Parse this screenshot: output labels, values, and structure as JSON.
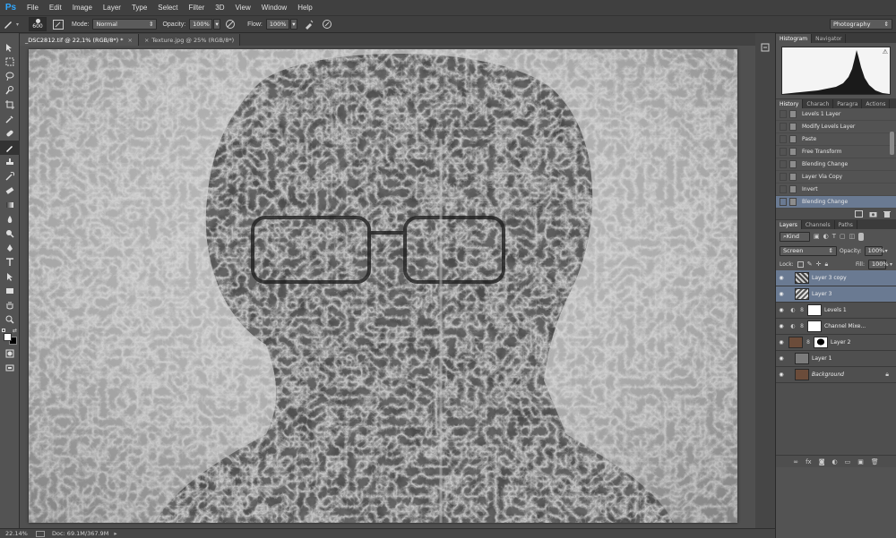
{
  "app": {
    "logo": "Ps"
  },
  "menu": [
    "File",
    "Edit",
    "Image",
    "Layer",
    "Type",
    "Select",
    "Filter",
    "3D",
    "View",
    "Window",
    "Help"
  ],
  "options": {
    "brush_size": "600",
    "mode_label": "Mode:",
    "mode_value": "Normal",
    "opacity_label": "Opacity:",
    "opacity_value": "100%",
    "flow_label": "Flow:",
    "flow_value": "100%",
    "workspace": "Photography"
  },
  "documents": [
    {
      "title": "_DSC2812.tif @ 22,1% (RGB/8*) *",
      "active": true
    },
    {
      "title": "Texture.jpg @ 25% (RGB/8*)",
      "active": false
    }
  ],
  "status": {
    "zoom": "22.14%",
    "doc_info": "Doc: 69.1M/367.9M"
  },
  "histogram_panel": {
    "tabs": [
      "Histogram",
      "Navigator"
    ]
  },
  "history_panel": {
    "tabs": [
      "History",
      "Charach",
      "Paragra",
      "Actions"
    ],
    "items": [
      {
        "label": "Levels 1 Layer",
        "selected": false
      },
      {
        "label": "Modify Levels Layer",
        "selected": false
      },
      {
        "label": "Paste",
        "selected": false
      },
      {
        "label": "Free Transform",
        "selected": false
      },
      {
        "label": "Blending Change",
        "selected": false
      },
      {
        "label": "Layer Via Copy",
        "selected": false
      },
      {
        "label": "Invert",
        "selected": false
      },
      {
        "label": "Blending Change",
        "selected": true
      }
    ]
  },
  "layers_panel": {
    "tabs": [
      "Layers",
      "Channels",
      "Paths"
    ],
    "filter": "Kind",
    "blend_mode": "Screen",
    "opacity_label": "Opacity:",
    "opacity_value": "100%",
    "lock_label": "Lock:",
    "fill_label": "Fill:",
    "fill_value": "100%",
    "layers": [
      {
        "name": "Layer 3 copy",
        "selected": true
      },
      {
        "name": "Layer 3",
        "selected": true
      },
      {
        "name": "Levels 1",
        "selected": false
      },
      {
        "name": "Channel Mixe...",
        "selected": false
      },
      {
        "name": "Layer 2",
        "selected": false
      },
      {
        "name": "Layer 1",
        "selected": false
      },
      {
        "name": "Background",
        "selected": false
      }
    ]
  }
}
